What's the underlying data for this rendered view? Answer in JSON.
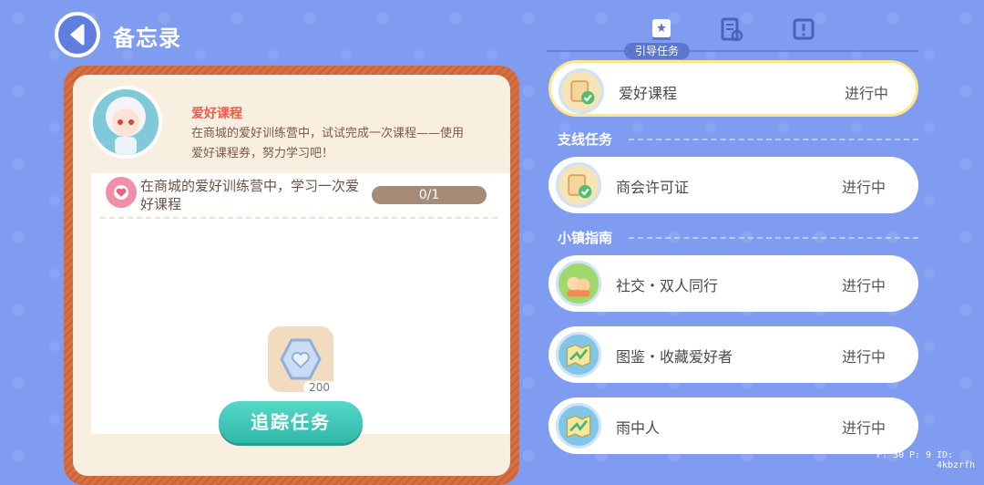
{
  "header": {
    "title": "备忘录"
  },
  "tabs": {
    "active_label": "引导任务"
  },
  "detail": {
    "quest_name": "爱好课程",
    "quest_desc": "在商城的爱好训练营中，试试完成一次课程——使用爱好课程券，努力学习吧！",
    "objective": "在商城的爱好训练营中，学习一次爱好课程",
    "progress": "0/1",
    "reward_count": "200",
    "track_button": "追踪任务"
  },
  "list": {
    "guide": [
      {
        "title": "爱好课程",
        "status": "进行中",
        "icon": "scroll-check-icon"
      }
    ],
    "side_header": "支线任务",
    "side": [
      {
        "title": "商会许可证",
        "status": "进行中",
        "icon": "scroll-check-icon"
      }
    ],
    "town_header": "小镇指南",
    "town": [
      {
        "title": "社交・双人同行",
        "status": "进行中",
        "icon": "friends-icon"
      },
      {
        "title": "图鉴・收藏爱好者",
        "status": "进行中",
        "icon": "map-icon"
      },
      {
        "title": "雨中人",
        "status": "进行中",
        "icon": "map-icon"
      }
    ]
  },
  "footer": {
    "f": "F: 30",
    "p": "P: 9",
    "id": "ID: 4kbzrfh"
  }
}
